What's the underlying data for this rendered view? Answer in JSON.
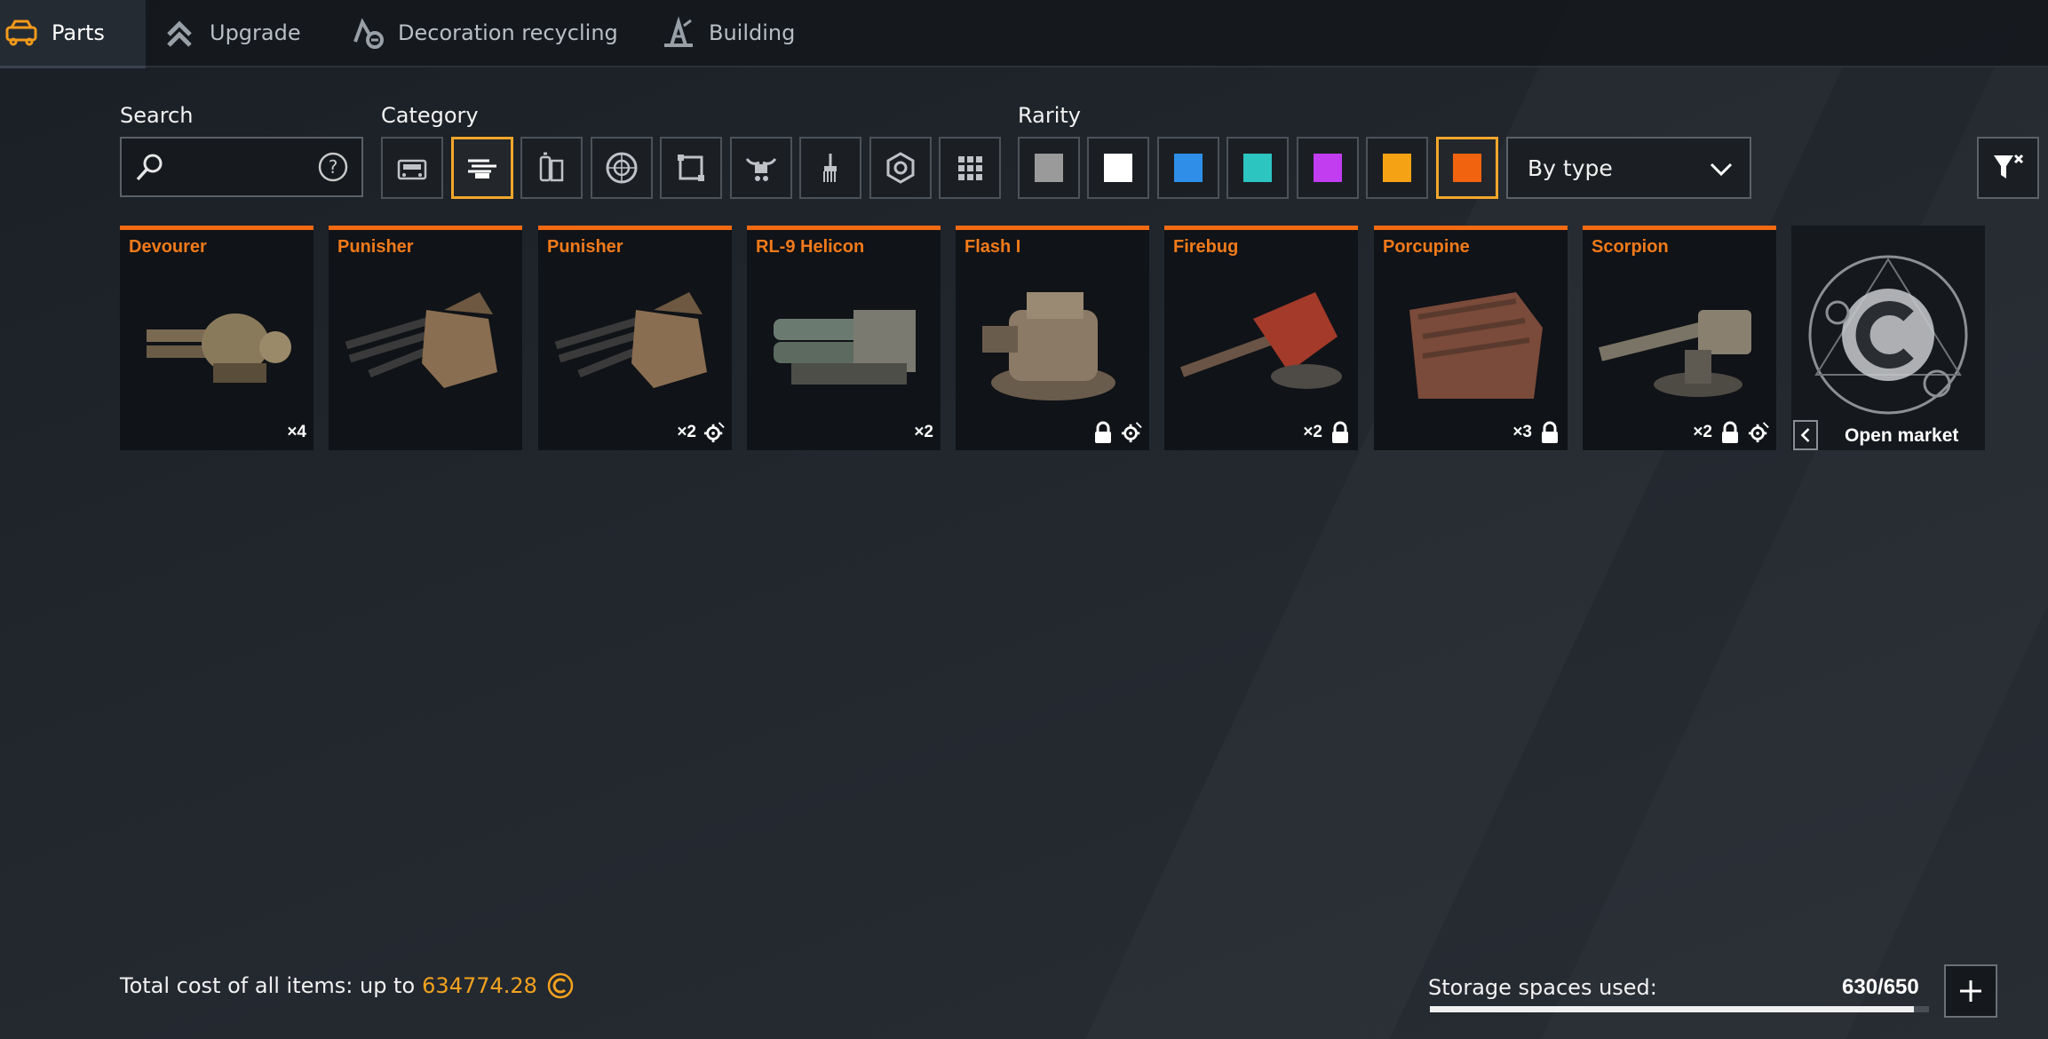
{
  "tabs": [
    {
      "label": "Parts",
      "icon": "car-icon",
      "active": true
    },
    {
      "label": "Upgrade",
      "icon": "chevrons-up-icon",
      "active": false
    },
    {
      "label": "Decoration recycling",
      "icon": "recycle-icon",
      "active": false
    },
    {
      "label": "Building",
      "icon": "construction-icon",
      "active": false
    }
  ],
  "filters": {
    "search_label": "Search",
    "search_value": "",
    "category_label": "Category",
    "categories": [
      {
        "icon": "car-body-icon",
        "selected": false
      },
      {
        "icon": "weapons-icon",
        "selected": true
      },
      {
        "icon": "modules-icon",
        "selected": false
      },
      {
        "icon": "wheel-icon",
        "selected": false
      },
      {
        "icon": "frame-icon",
        "selected": false
      },
      {
        "icon": "decor-icon",
        "selected": false
      },
      {
        "icon": "paint-brush-icon",
        "selected": false
      },
      {
        "icon": "gear-nut-icon",
        "selected": false
      },
      {
        "icon": "grid-all-icon",
        "selected": false
      }
    ],
    "rarity_label": "Rarity",
    "rarities": [
      {
        "name": "common",
        "color": "#9a9a9a",
        "selected": false
      },
      {
        "name": "uncommon",
        "color": "#ffffff",
        "selected": false
      },
      {
        "name": "rare",
        "color": "#2f8fe8",
        "selected": false
      },
      {
        "name": "special",
        "color": "#2cc5c0",
        "selected": false
      },
      {
        "name": "epic",
        "color": "#c23cf0",
        "selected": false
      },
      {
        "name": "legendary",
        "color": "#f5a314",
        "selected": false
      },
      {
        "name": "relic",
        "color": "#f2630f",
        "selected": true
      }
    ],
    "sort_value": "By type"
  },
  "items": [
    {
      "name": "Devourer",
      "count": "×4",
      "lock": false,
      "gear": false
    },
    {
      "name": "Punisher",
      "count": "",
      "lock": false,
      "gear": false
    },
    {
      "name": "Punisher",
      "count": "×2",
      "lock": false,
      "gear": true
    },
    {
      "name": "RL-9 Helicon",
      "count": "×2",
      "lock": false,
      "gear": false
    },
    {
      "name": "Flash I",
      "count": "",
      "lock": true,
      "gear": true
    },
    {
      "name": "Firebug",
      "count": "×2",
      "lock": true,
      "gear": false
    },
    {
      "name": "Porcupine",
      "count": "×3",
      "lock": true,
      "gear": false
    },
    {
      "name": "Scorpion",
      "count": "×2",
      "lock": true,
      "gear": true
    }
  ],
  "market": {
    "label": "Open market"
  },
  "footer": {
    "total_label": "Total cost of all items: up to",
    "total_value": "634774.28",
    "storage_label": "Storage spaces used:",
    "storage_value": "630/650",
    "storage_used": 630,
    "storage_max": 650
  }
}
